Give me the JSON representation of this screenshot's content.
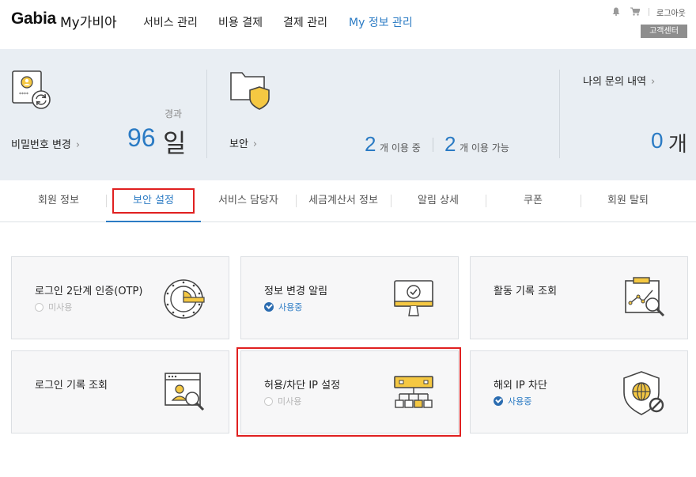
{
  "header": {
    "logo": "Gabia",
    "logo_sub": "My가비아",
    "nav": [
      "서비스 관리",
      "비용 결제",
      "결제 관리",
      "My 정보 관리"
    ],
    "logout": "로그아웃",
    "support": "고객센터"
  },
  "summary": {
    "password": {
      "label": "비밀번호 변경",
      "elapsed_label": "경과",
      "value": "96",
      "unit": "일"
    },
    "security": {
      "label": "보안",
      "in_use_count": "2",
      "in_use_label": "개 이용 중",
      "available_count": "2",
      "available_label": "개 이용 가능"
    },
    "inquiry": {
      "label": "나의 문의 내역",
      "count": "0",
      "unit": "개"
    }
  },
  "tabs": [
    "회원 정보",
    "보안 설정",
    "서비스 담당자",
    "세금계산서 정보",
    "알림 상세",
    "쿠폰",
    "회원 탈퇴"
  ],
  "cards": [
    {
      "title": "로그인 2단계 인증(OTP)",
      "status": "미사용",
      "icon": "otp-dial-icon"
    },
    {
      "title": "정보 변경 알림",
      "status": "사용중",
      "icon": "monitor-check-icon"
    },
    {
      "title": "활동 기록 조회",
      "status": "",
      "icon": "chart-magnifier-icon"
    },
    {
      "title": "로그인 기록 조회",
      "status": "",
      "icon": "user-search-window-icon"
    },
    {
      "title": "허용/차단 IP 설정",
      "status": "미사용",
      "icon": "network-tree-icon"
    },
    {
      "title": "해외 IP 차단",
      "status": "사용중",
      "icon": "globe-shield-block-icon"
    }
  ],
  "colors": {
    "accent": "#2b7bc4",
    "highlight": "#e02020",
    "icon_yellow": "#f5c842"
  }
}
